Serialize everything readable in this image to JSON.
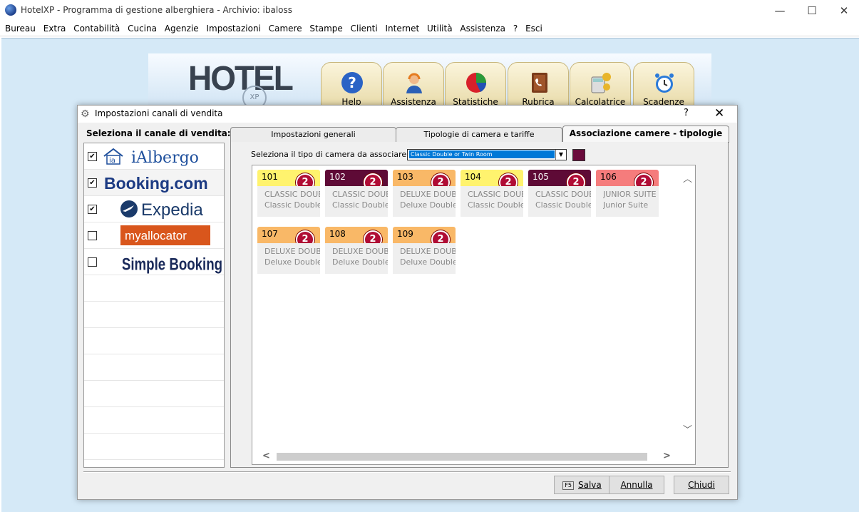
{
  "window": {
    "title": "HotelXP - Programma di gestione alberghiera - Archivio: ibaloss",
    "minimize": "—",
    "maximize": "☐",
    "close": "✕"
  },
  "menu": [
    "Bureau",
    "Extra",
    "Contabilità",
    "Cucina",
    "Agenzie",
    "Impostazioni",
    "Camere",
    "Stampe",
    "Clienti",
    "Internet",
    "Utilità",
    "Assistenza",
    "?",
    "Esci"
  ],
  "toolbar": {
    "logo": "HOTEL",
    "logo_sub": "XP",
    "buttons": [
      {
        "label": "Help",
        "icon": "help-icon"
      },
      {
        "label": "Assistenza",
        "icon": "support-agent-icon"
      },
      {
        "label": "Statistiche",
        "icon": "pie-chart-icon"
      },
      {
        "label": "Rubrica",
        "icon": "address-book-icon"
      },
      {
        "label": "Calcolatrice",
        "icon": "calculator-icon"
      },
      {
        "label": "Scadenze",
        "icon": "alarm-clock-icon"
      }
    ]
  },
  "dialog": {
    "title": "Impostazioni canali di vendita",
    "help": "?",
    "close": "✕",
    "channels_header": "Seleziona il canale di vendita:",
    "channels": [
      {
        "name": "iAlbergo",
        "checked": true
      },
      {
        "name": "Booking.com",
        "checked": true
      },
      {
        "name": "Expedia",
        "checked": true
      },
      {
        "name": "myallocator",
        "checked": false
      },
      {
        "name": "Simple Booking™",
        "checked": false
      }
    ],
    "tabs": [
      "Impostazioni generali",
      "Tipologie di camera e tariffe",
      "Associazione camere - tipologie"
    ],
    "active_tab": 2,
    "room_type_label": "Seleziona il tipo di camera da associare:",
    "room_type_value": "Classic Double or Twin Room",
    "swatch_color": "#6a0a3b",
    "rooms": [
      {
        "number": "101",
        "badge": "2",
        "type": "CLASSIC DOUB...",
        "desc": "Classic Double...",
        "color": "#fff36e",
        "dark": false
      },
      {
        "number": "102",
        "badge": "2",
        "type": "CLASSIC DOUB...",
        "desc": "Classic Double...",
        "color": "#5e0a36",
        "dark": true
      },
      {
        "number": "103",
        "badge": "2",
        "type": "DELUXE DOUBLE",
        "desc": "Deluxe Double ...",
        "color": "#f9b867",
        "dark": false
      },
      {
        "number": "104",
        "badge": "2",
        "type": "CLASSIC DOUB...",
        "desc": "Classic Double...",
        "color": "#fff36e",
        "dark": false
      },
      {
        "number": "105",
        "badge": "2",
        "type": "CLASSIC DOUB...",
        "desc": "Classic Double...",
        "color": "#5e0a36",
        "dark": true
      },
      {
        "number": "106",
        "badge": "2",
        "type": "JUNIOR SUITE",
        "desc": "Junior Suite",
        "color": "#f57c7c",
        "dark": false
      },
      {
        "number": "107",
        "badge": "2",
        "type": "DELUXE DOUBLE",
        "desc": "Deluxe Double ...",
        "color": "#f9b867",
        "dark": false
      },
      {
        "number": "108",
        "badge": "2",
        "type": "DELUXE DOUBLE",
        "desc": "Deluxe Double ...",
        "color": "#f9b867",
        "dark": false
      },
      {
        "number": "109",
        "badge": "2",
        "type": "DELUXE DOUBLE",
        "desc": "Deluxe Double ...",
        "color": "#f9b867",
        "dark": false
      }
    ],
    "buttons": {
      "save_key": "F5",
      "save": "Salva",
      "cancel": "Annulla",
      "close": "Chiudi"
    }
  }
}
